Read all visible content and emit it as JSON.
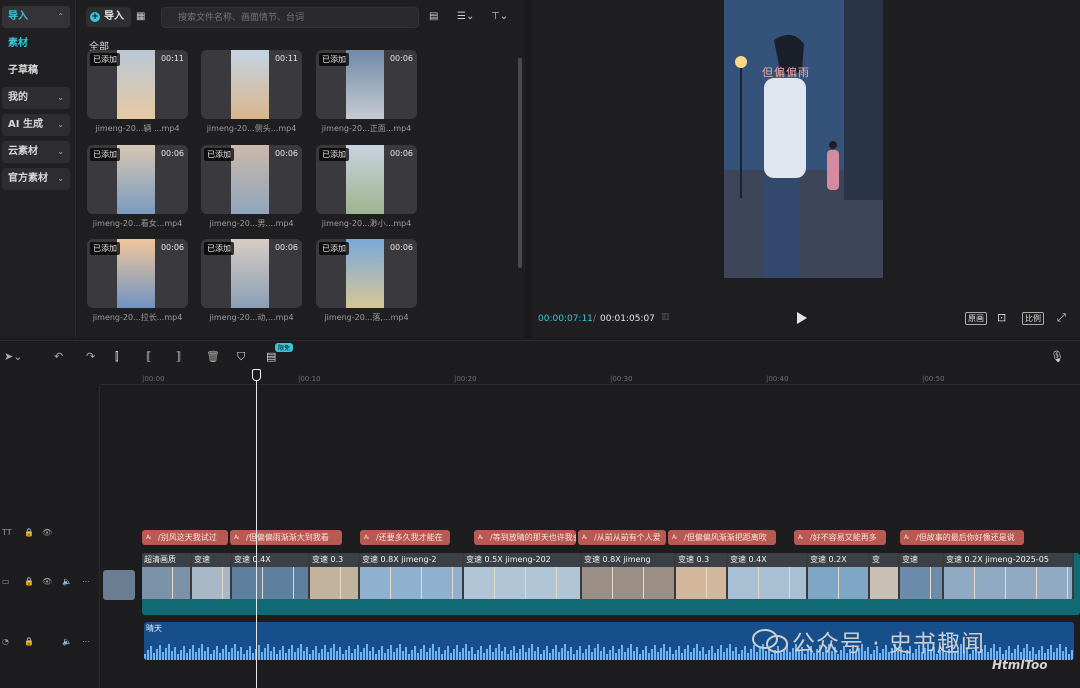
{
  "sidebar": {
    "items": [
      {
        "label": "导入"
      },
      {
        "label": "素材"
      },
      {
        "label": "子草稿"
      },
      {
        "label": "我的"
      },
      {
        "label": "AI 生成"
      },
      {
        "label": "云素材"
      },
      {
        "label": "官方素材"
      }
    ]
  },
  "media": {
    "import_label": "导入",
    "search_placeholder": "搜索文件名称、画面情节、台词",
    "section_label": "全部",
    "cards": [
      {
        "name": "jimeng-20...辆 ...mp4",
        "duration": "00:11",
        "added": "已添加"
      },
      {
        "name": "jimeng-20...侧头...mp4",
        "duration": "00:11",
        "added": ""
      },
      {
        "name": "jimeng-20...正面...mp4",
        "duration": "00:06",
        "added": "已添加"
      },
      {
        "name": "jimeng-20...看女...mp4",
        "duration": "00:06",
        "added": "已添加"
      },
      {
        "name": "jimeng-20...男....mp4",
        "duration": "00:06",
        "added": "已添加"
      },
      {
        "name": "jimeng-20...渺小...mp4",
        "duration": "00:06",
        "added": "已添加"
      },
      {
        "name": "jimeng-20...拉长...mp4",
        "duration": "00:06",
        "added": "已添加"
      },
      {
        "name": "jimeng-20...动,...mp4",
        "duration": "00:06",
        "added": "已添加"
      },
      {
        "name": "jimeng-20...落,...mp4",
        "duration": "00:06",
        "added": "已添加"
      }
    ]
  },
  "preview": {
    "caption": "但偏偏雨",
    "timecode_current": "00:00:07:11",
    "timecode_separator": "/",
    "timecode_total": "00:01:05:07",
    "btn_original": "原画",
    "btn_ratio": "比例"
  },
  "timeline": {
    "free_badge": "限免",
    "ticks": [
      "|00:00",
      "|00:10",
      "|00:20",
      "|00:30",
      "|00:40",
      "|00:50"
    ],
    "text_clips": [
      {
        "text": "/别风这天我试过"
      },
      {
        "text": "/但偏偏雨渐渐大到我看"
      },
      {
        "text": "/还要多久我才能在"
      },
      {
        "text": "/等到放晴的那天也许我会"
      },
      {
        "text": "/从前从前有个人爱"
      },
      {
        "text": "/但偏偏风渐渐把距离吹"
      },
      {
        "text": "/好不容易又能再多"
      },
      {
        "text": "/但故事的最后你好像还是说"
      }
    ],
    "video_segments": [
      {
        "label": "超清画质"
      },
      {
        "label": "变速"
      },
      {
        "label": "变速 0.4X"
      },
      {
        "label": "变速 0.3"
      },
      {
        "label": "变速 0.8X  jimeng-2"
      },
      {
        "label": "变速 0.5X  jimeng-202"
      },
      {
        "label": "变速 0.8X  jimeng"
      },
      {
        "label": "变速 0.3"
      },
      {
        "label": "变速 0.4X"
      },
      {
        "label": "变速 0.2X"
      },
      {
        "label": "变"
      },
      {
        "label": "变速"
      },
      {
        "label": "变速 0.2X  jimeng-2025-05"
      }
    ],
    "audio_label": "晴天"
  },
  "watermark": {
    "text": "公众号 · 史书趣闻",
    "sub": "HtmlToo"
  },
  "colors": {
    "accent": "#39c5d9",
    "text_clip": "#b95a52",
    "video_track": "#0f6a73",
    "audio_track": "#174f8c"
  }
}
